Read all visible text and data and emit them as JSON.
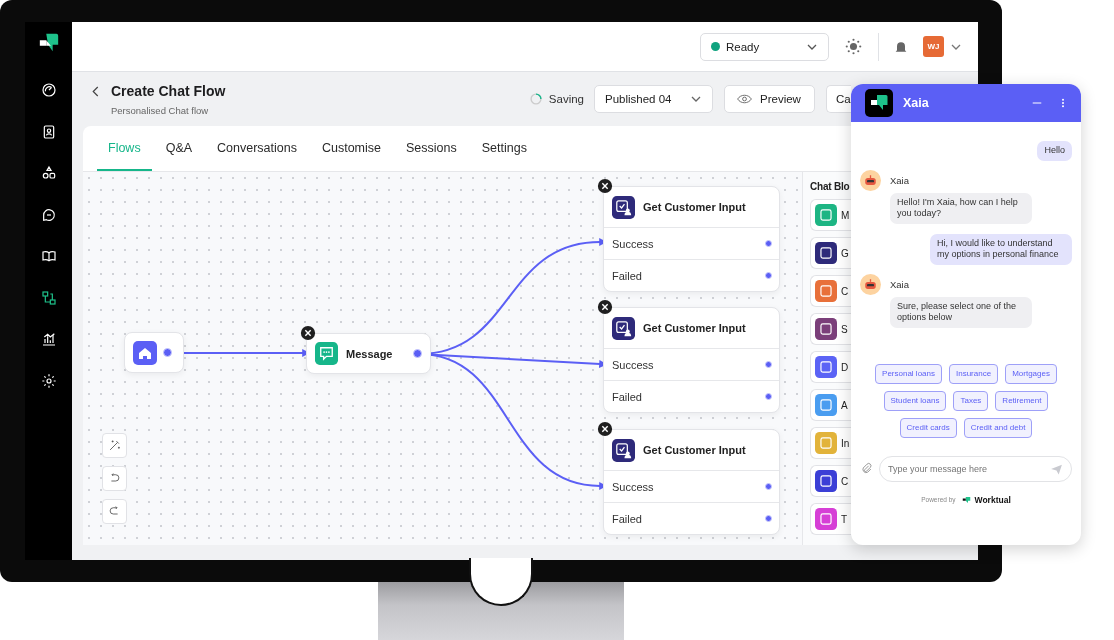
{
  "sidebar": {
    "items": [
      {
        "kind": "gauge",
        "selected": false
      },
      {
        "kind": "contacts",
        "selected": false
      },
      {
        "kind": "shapes",
        "selected": false
      },
      {
        "kind": "chat",
        "selected": false
      },
      {
        "kind": "book",
        "selected": false
      },
      {
        "kind": "flow",
        "selected": true
      },
      {
        "kind": "chart",
        "selected": false
      },
      {
        "kind": "settings",
        "selected": false
      }
    ]
  },
  "top_bar": {
    "status": "Ready",
    "avatar": "WJ"
  },
  "header": {
    "title": "Create Chat Flow",
    "subtitle": "Personalised Chat flow",
    "save_status": "Saving",
    "version": "Published 04",
    "preview": "Preview",
    "cut_button": "Ca"
  },
  "tabs": [
    {
      "label": "Flows",
      "selected": true
    },
    {
      "label": "Q&A",
      "selected": false
    },
    {
      "label": "Conversations",
      "selected": false
    },
    {
      "label": "Customise",
      "selected": false
    },
    {
      "label": "Sessions",
      "selected": false
    },
    {
      "label": "Settings",
      "selected": false
    }
  ],
  "canvas": {
    "nodes": [
      {
        "kind": "start"
      },
      {
        "kind": "message",
        "label": "Message"
      },
      {
        "kind": "input",
        "label": "Get Customer Input",
        "outputs": [
          "Success",
          "Failed"
        ]
      },
      {
        "kind": "input",
        "label": "Get Customer Input",
        "outputs": [
          "Success",
          "Failed"
        ]
      },
      {
        "kind": "input",
        "label": "Get Customer Input",
        "outputs": [
          "Success",
          "Failed"
        ]
      }
    ]
  },
  "chat_blocks": {
    "title": "Chat Blo",
    "items": [
      {
        "label": "M",
        "color": "#1db583"
      },
      {
        "label": "G",
        "color": "#2e2a7a"
      },
      {
        "label": "C",
        "color": "#e8703a"
      },
      {
        "label": "S",
        "color": "#7b3f7a"
      },
      {
        "label": "D",
        "color": "#5b63f5"
      },
      {
        "label": "A",
        "color": "#4a9df0"
      },
      {
        "label": "In",
        "color": "#e2b33a"
      },
      {
        "label": "C",
        "color": "#3b3fd6"
      },
      {
        "label": "T",
        "color": "#d63fd6"
      }
    ]
  },
  "chat_widget": {
    "title": "Xaia",
    "messages": [
      {
        "kind": "user",
        "text": "Hello"
      },
      {
        "kind": "bot",
        "sender": "Xaia",
        "text": "Hello! I'm Xaia, how can I help you today?"
      },
      {
        "kind": "user",
        "text": "Hi, I would like to understand my options in personal finance"
      },
      {
        "kind": "bot",
        "sender": "Xaia",
        "text": "Sure, please select one of the options below"
      }
    ],
    "option_rows": [
      [
        "Personal loans",
        "Insurance",
        "Mortgages"
      ],
      [
        "Student loans",
        "Taxes",
        "Retirement"
      ],
      [
        "Credit cards",
        "Credit and debt"
      ]
    ],
    "input": {
      "placeholder": "Type your message here"
    },
    "footer": {
      "powered_by": "Powered by",
      "brand": "Worktual"
    }
  }
}
